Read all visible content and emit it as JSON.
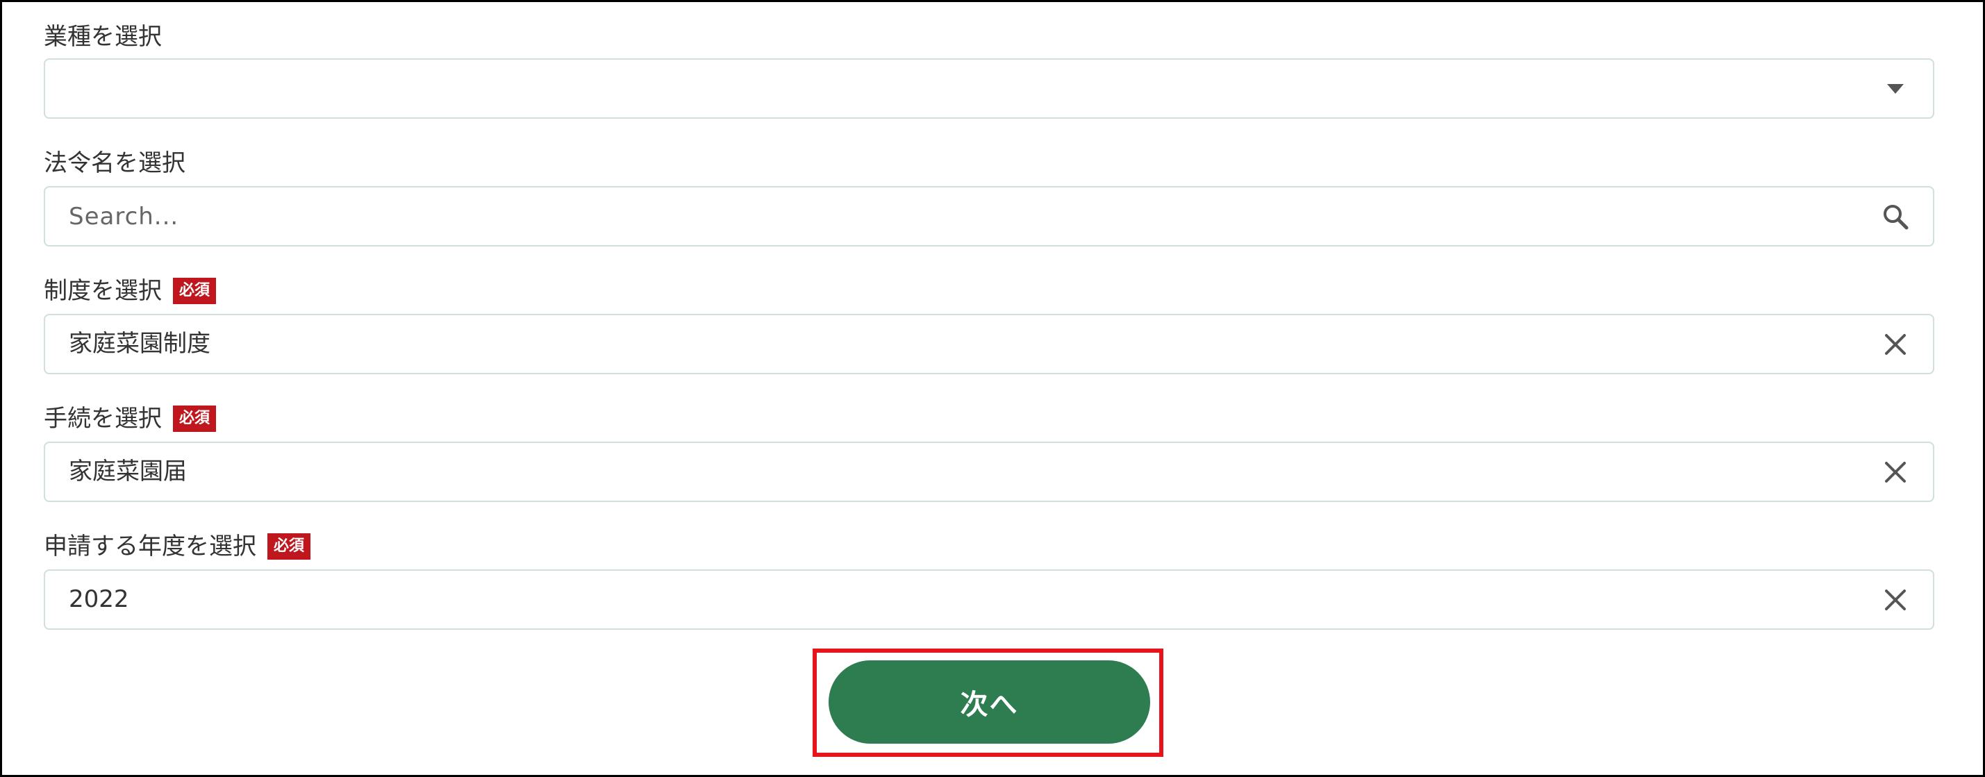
{
  "form": {
    "industry": {
      "label": "業種を選択",
      "value": "",
      "icon": "caret-down-icon"
    },
    "law": {
      "label": "法令名を選択",
      "placeholder": "Search...",
      "icon": "search-icon"
    },
    "system": {
      "label": "制度を選択",
      "required_badge": "必須",
      "value": "家庭菜園制度",
      "icon": "clear-icon"
    },
    "procedure": {
      "label": "手続を選択",
      "required_badge": "必須",
      "value": "家庭菜園届",
      "icon": "clear-icon"
    },
    "fiscal_year": {
      "label": "申請する年度を選択",
      "required_badge": "必須",
      "value": "2022",
      "icon": "clear-icon"
    }
  },
  "next_button": {
    "label": "次へ"
  },
  "colors": {
    "button_green": "#2d7d51",
    "required_red": "#c0161d",
    "highlight_red": "#e8141c",
    "field_border": "#cfe0de"
  }
}
